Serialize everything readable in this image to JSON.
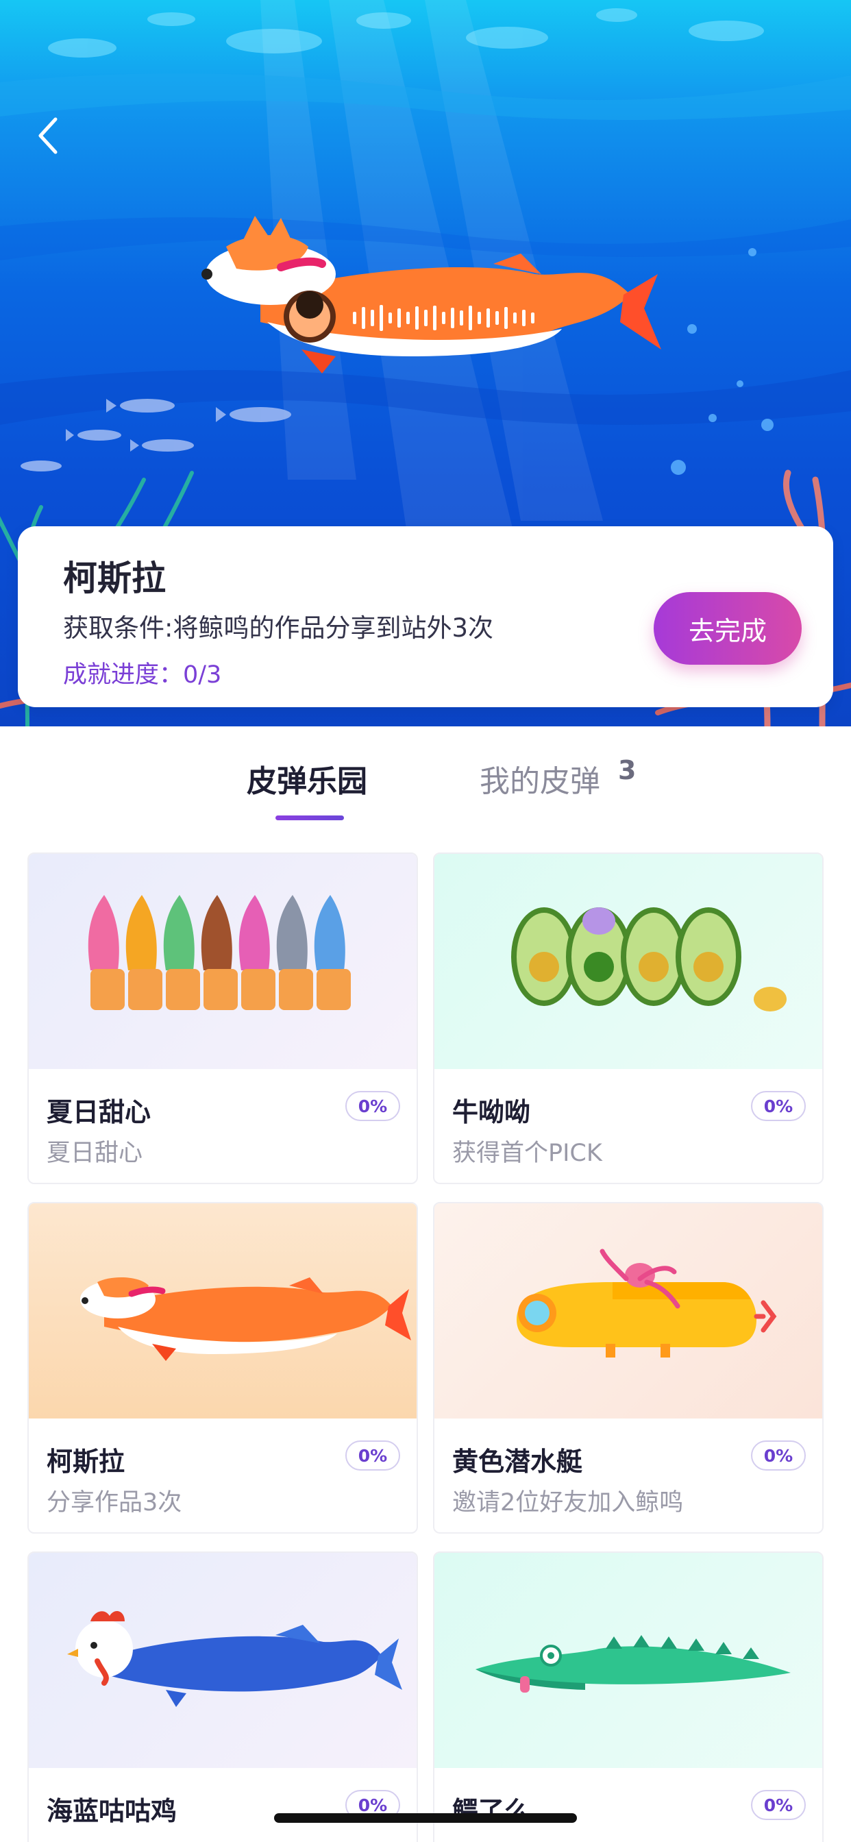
{
  "hero": {
    "current_skin": {
      "title": "柯斯拉",
      "condition": "获取条件:将鲸鸣的作品分享到站外3次",
      "progress": "成就进度：0/3",
      "progress_value": 0,
      "progress_total": 3,
      "action_label": "去完成"
    }
  },
  "tabs": [
    {
      "label": "皮弹乐园",
      "active": true
    },
    {
      "label": "我的皮弹",
      "count": "3",
      "active": false
    }
  ],
  "skins": [
    {
      "name": "夏日甜心",
      "desc": "夏日甜心",
      "progress": "0%",
      "art": "ice-cream-row"
    },
    {
      "name": "牛呦呦",
      "desc": "获得首个PICK",
      "progress": "0%",
      "art": "avocado-row"
    },
    {
      "name": "柯斯拉",
      "desc": "分享作品3次",
      "progress": "0%",
      "art": "corgi-fish"
    },
    {
      "name": "黄色潜水艇",
      "desc": "邀请2位好友加入鲸鸣",
      "progress": "0%",
      "art": "yellow-submarine"
    },
    {
      "name": "海蓝咕咕鸡",
      "desc": "",
      "progress": "0%",
      "art": "rooster-fish"
    },
    {
      "name": "鳄了么",
      "desc": "",
      "progress": "0%",
      "art": "crocodile"
    }
  ],
  "colors": {
    "accent": "#7a3fd6",
    "button_gradient_start": "#a63ad8",
    "button_gradient_end": "#d84aa9",
    "ocean_top": "#16c6f4",
    "ocean_bottom": "#0b44c6"
  }
}
